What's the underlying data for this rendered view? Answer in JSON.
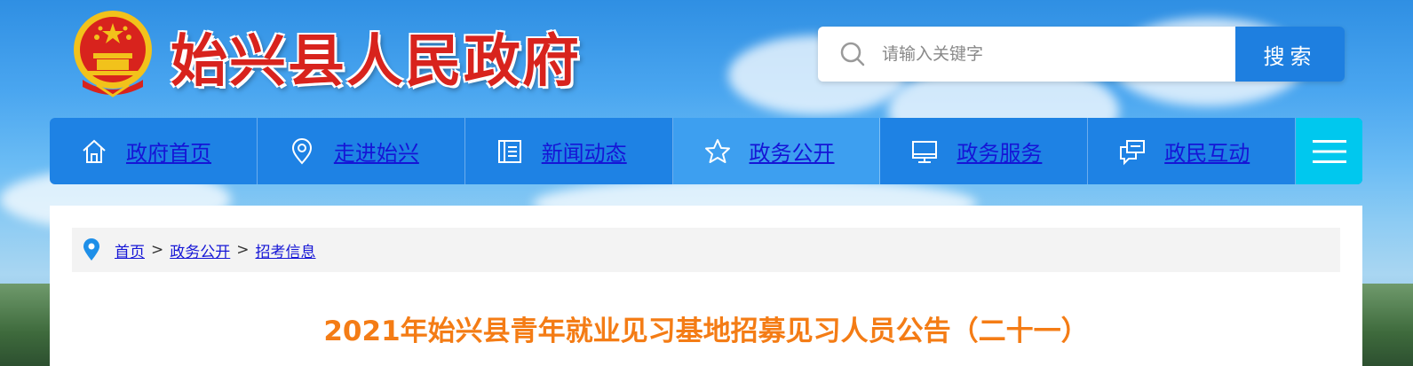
{
  "header": {
    "site_title": "始兴县人民政府",
    "emblem_icon": "national-emblem-icon"
  },
  "search": {
    "placeholder": "请输入关键字",
    "button_label": "搜索"
  },
  "nav": {
    "items": [
      {
        "label": "政府首页",
        "icon": "home-icon"
      },
      {
        "label": "走进始兴",
        "icon": "location-pin-icon"
      },
      {
        "label": "新闻动态",
        "icon": "document-list-icon"
      },
      {
        "label": "政务公开",
        "icon": "star-icon"
      },
      {
        "label": "政务服务",
        "icon": "monitor-icon"
      },
      {
        "label": "政民互动",
        "icon": "chat-icon"
      }
    ],
    "active_index": 3,
    "menu_icon": "hamburger-menu-icon"
  },
  "breadcrumb": {
    "items": [
      "首页",
      "政务公开",
      "招考信息"
    ],
    "separator": ">"
  },
  "article": {
    "title": "2021年始兴县青年就业见习基地招募见习人员公告（二十一）"
  },
  "colors": {
    "nav_bg": "#1e82e4",
    "nav_active": "#3d9ff0",
    "menu_accent": "#00c8ee",
    "title_orange": "#f47c15",
    "site_title_red": "#d8231d",
    "search_button": "#1e7fe0"
  }
}
